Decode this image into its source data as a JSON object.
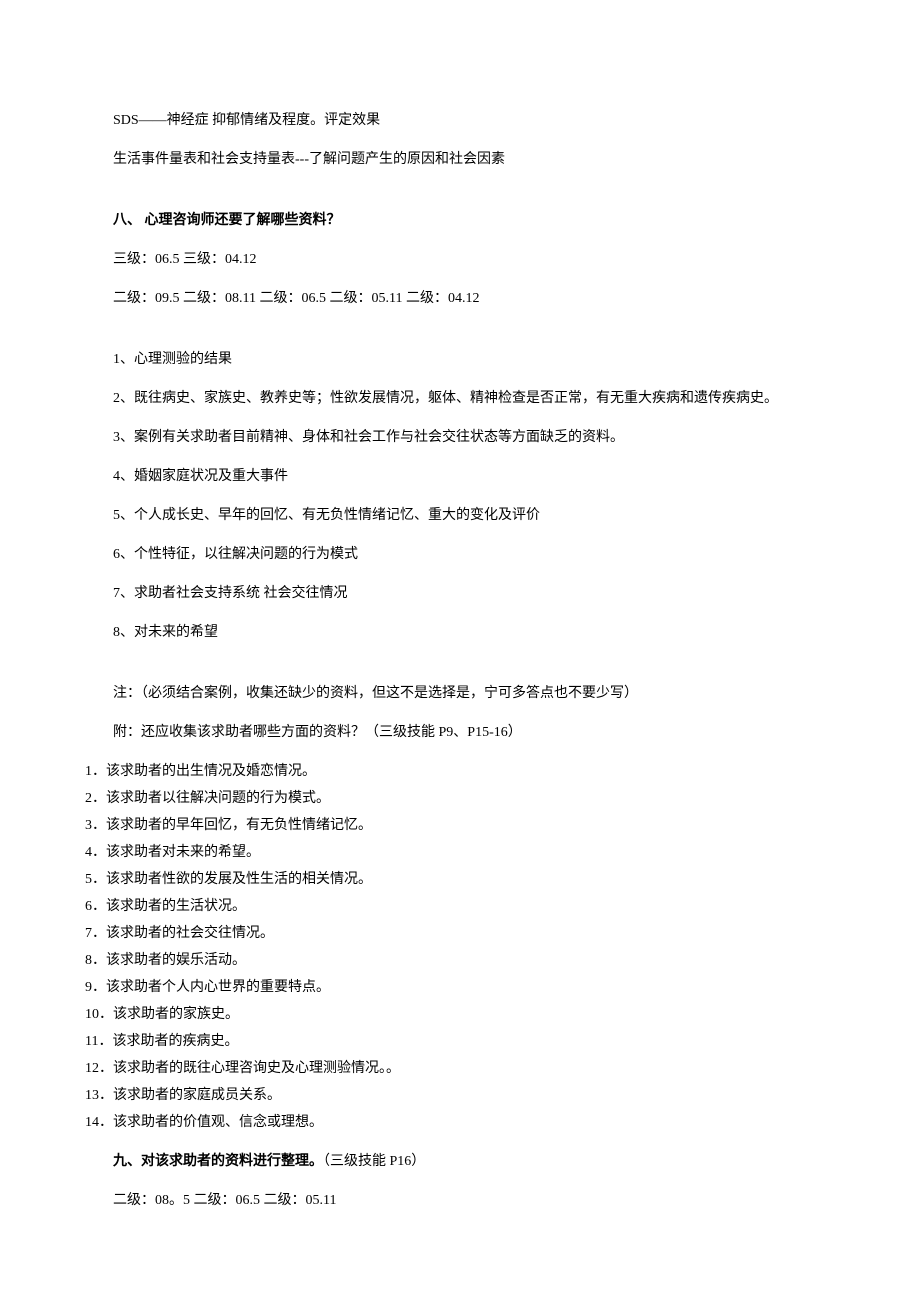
{
  "p1": "SDS——神经症  抑郁情绪及程度。评定效果",
  "p2": "生活事件量表和社会支持量表---了解问题产生的原因和社会因素",
  "s8_title": "八、 心理咨询师还要了解哪些资料？",
  "s8_line1": "三级：06.5 三级：04.12",
  "s8_line2": "二级：09.5 二级：08.11 二级：06.5 二级：05.11 二级：04.12",
  "s8_items": [
    "1、心理测验的结果",
    "2、既往病史、家族史、教养史等；性欲发展情况，躯体、精神检查是否正常，有无重大疾病和遗传疾病史。",
    "3、案例有关求助者目前精神、身体和社会工作与社会交往状态等方面缺乏的资料。",
    "4、婚姻家庭状况及重大事件",
    "5、个人成长史、早年的回忆、有无负性情绪记忆、重大的变化及评价",
    "6、个性特征，以往解决问题的行为模式",
    "7、求助者社会支持系统 社会交往情况",
    "8、对未来的希望"
  ],
  "note": "注：（必须结合案例，收集还缺少的资料，但这不是选择是，宁可多答点也不要少写）",
  "appendix_title": "附：还应收集该求助者哪些方面的资料？（三级技能 P9、P15-16）",
  "appendix_items": [
    "1．该求助者的出生情况及婚恋情况。",
    "2．该求助者以往解决问题的行为模式。",
    "3．该求助者的早年回忆，有无负性情绪记忆。",
    "4．该求助者对未来的希望。",
    "5．该求助者性欲的发展及性生活的相关情况。",
    "6．该求助者的生活状况。",
    "7．该求助者的社会交往情况。",
    "8．该求助者的娱乐活动。",
    "9．该求助者个人内心世界的重要特点。",
    "10．该求助者的家族史。",
    "11．该求助者的疾病史。",
    "12．该求助者的既往心理咨询史及心理测验情况。。",
    "13．该求助者的家庭成员关系。",
    "14．该求助者的价值观、信念或理想。"
  ],
  "s9_title_bold": "九、对该求助者的资料进行整理。",
  "s9_title_rest": "（三级技能 P16）",
  "s9_line": "二级：08。5 二级：06.5 二级：05.11"
}
